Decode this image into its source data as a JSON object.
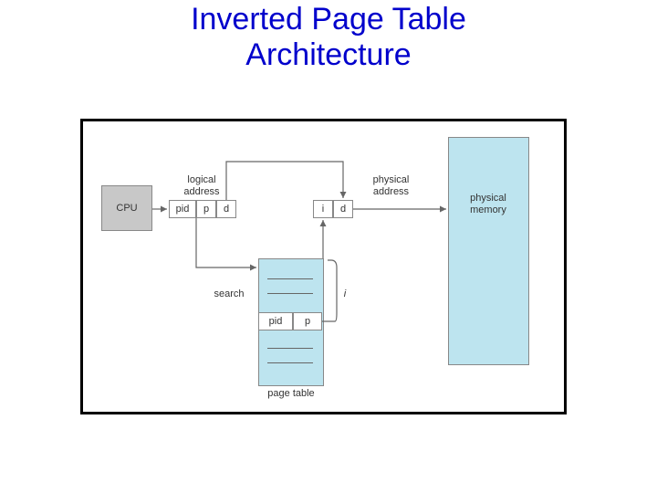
{
  "title_line1": "Inverted Page Table",
  "title_line2": "Architecture",
  "cpu": "CPU",
  "logical_address": "logical\naddress",
  "physical_address": "physical\naddress",
  "physical_memory": "physical\nmemory",
  "page_table": "page table",
  "search": "search",
  "pid": "pid",
  "p": "p",
  "d": "d",
  "i": "i",
  "i_index": "i"
}
